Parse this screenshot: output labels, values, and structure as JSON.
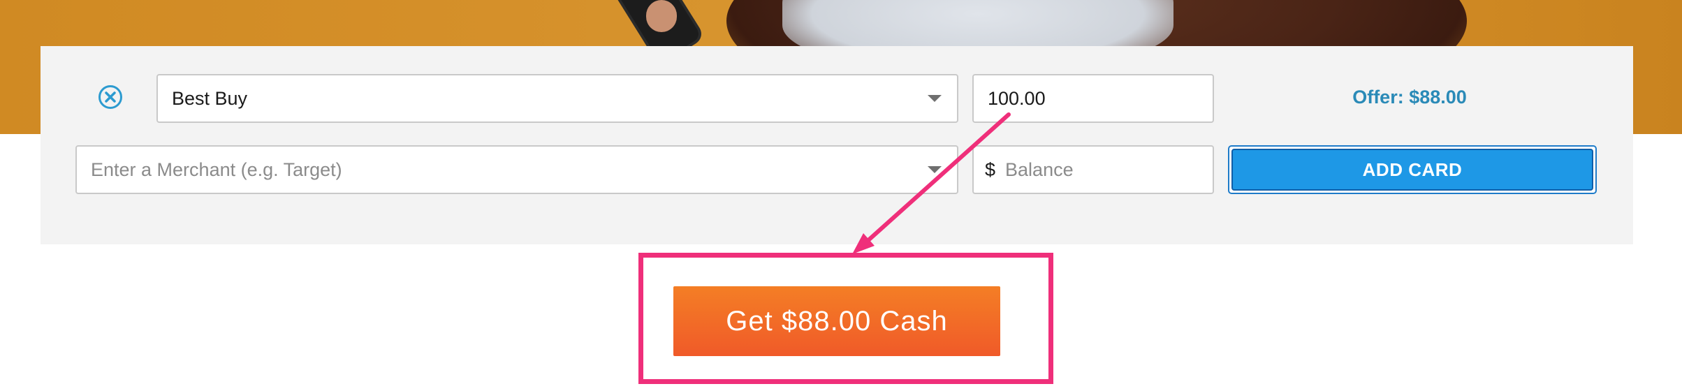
{
  "row1": {
    "remove_icon": "close-circle-icon",
    "merchant_value": "Best Buy",
    "amount_value": "100.00",
    "offer_text": "Offer: $88.00"
  },
  "row2": {
    "merchant_placeholder": "Enter a Merchant (e.g. Target)",
    "currency_symbol": "$",
    "balance_placeholder": "Balance",
    "add_card_label": "ADD CARD"
  },
  "cta": {
    "label": "Get $88.00 Cash"
  },
  "colors": {
    "accent_blue": "#1e98e6",
    "offer_text": "#2a8ab7",
    "cta_orange": "#f05a29",
    "highlight_pink": "#ef2f7a"
  }
}
